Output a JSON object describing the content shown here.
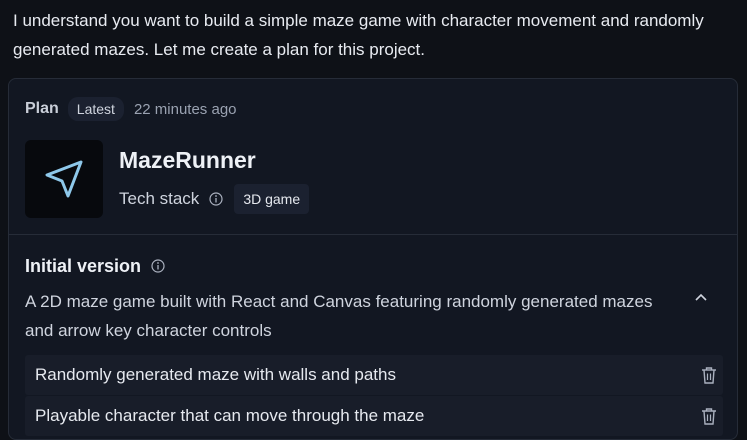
{
  "message": {
    "text": "I understand you want to build a simple maze game with character movement and randomly generated mazes. Let me create a plan for this project."
  },
  "plan": {
    "label": "Plan",
    "badge": "Latest",
    "timestamp": "22 minutes ago",
    "app_icon": "navigation-arrow-icon",
    "app_name": "MazeRunner",
    "tech_stack_label": "Tech stack",
    "tech_stack_value": "3D game"
  },
  "version": {
    "title": "Initial version",
    "description": "A 2D maze game built with React and Canvas featuring randomly generated mazes and arrow key character controls",
    "features": [
      {
        "label": "Randomly generated maze with walls and paths"
      },
      {
        "label": "Playable character that can move through the maze"
      }
    ]
  },
  "colors": {
    "background": "#0e1117",
    "card": "#121722",
    "feature_row": "#181d29",
    "icon_accent": "#8ec8ea"
  }
}
